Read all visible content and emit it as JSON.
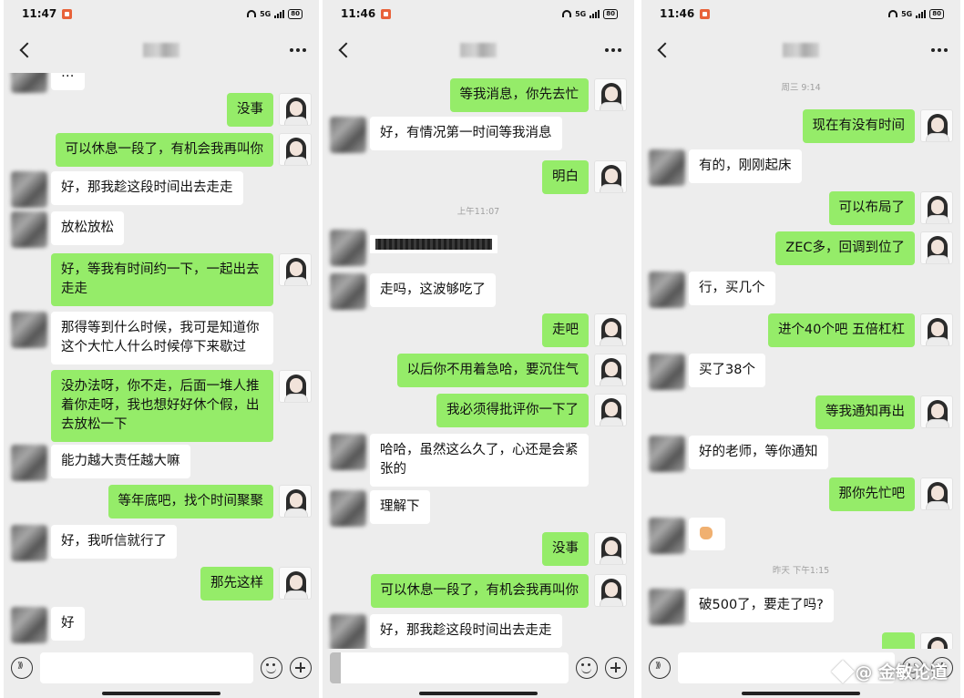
{
  "panels": [
    {
      "status": {
        "time": "11:47",
        "network": "5G",
        "battery": "80"
      },
      "messages": [
        {
          "side": "in",
          "text": "…"
        },
        {
          "side": "out",
          "text": "没事"
        },
        {
          "side": "out",
          "text": "可以休息一段了，有机会我再叫你"
        },
        {
          "side": "in",
          "text": "好，那我趁这段时间出去走走"
        },
        {
          "side": "in",
          "text": "放松放松"
        },
        {
          "side": "out",
          "text": "好，等我有时间约一下，一起出去走走"
        },
        {
          "side": "in",
          "text": "那得等到什么时候，我可是知道你这个大忙人什么时候停下来歇过"
        },
        {
          "side": "out",
          "text": "没办法呀，你不走，后面一堆人推着你走呀，我也想好好休个假，出去放松一下"
        },
        {
          "side": "in",
          "text": "能力越大责任越大嘛"
        },
        {
          "side": "out",
          "text": "等年底吧，找个时间聚聚"
        },
        {
          "side": "in",
          "text": "好，我听信就行了"
        },
        {
          "side": "out",
          "text": "那先这样"
        },
        {
          "side": "in",
          "text": "好"
        }
      ]
    },
    {
      "status": {
        "time": "11:46",
        "network": "5G",
        "battery": "80"
      },
      "messages": [
        {
          "side": "out",
          "text": "等我消息，你先去忙"
        },
        {
          "side": "in",
          "text": "好，有情况第一时间等我消息"
        },
        {
          "side": "out",
          "text": "明白"
        },
        {
          "type": "time",
          "text": "上午11:07"
        },
        {
          "side": "in",
          "text": "",
          "redacted": true
        },
        {
          "side": "in",
          "text": "走吗，这波够吃了"
        },
        {
          "side": "out",
          "text": "走吧"
        },
        {
          "side": "out",
          "text": "以后你不用着急哈，要沉住气"
        },
        {
          "side": "out",
          "text": "我必须得批评你一下了"
        },
        {
          "side": "in",
          "text": "哈哈，虽然这么久了，心还是会紧张的"
        },
        {
          "side": "in",
          "text": "理解下"
        },
        {
          "side": "out",
          "text": "没事"
        },
        {
          "side": "out",
          "text": "可以休息一段了，有机会我再叫你"
        },
        {
          "side": "in",
          "text": "好，那我趁这段时间出去走走"
        }
      ]
    },
    {
      "status": {
        "time": "11:46",
        "network": "5G",
        "battery": "80"
      },
      "messages": [
        {
          "type": "time",
          "text": "周三 9:14"
        },
        {
          "side": "out",
          "text": "现在有没有时间"
        },
        {
          "side": "in",
          "text": "有的，刚刚起床"
        },
        {
          "side": "out",
          "text": "可以布局了"
        },
        {
          "side": "out",
          "text": "ZEC多，回调到位了"
        },
        {
          "side": "in",
          "text": "行，买几个"
        },
        {
          "side": "out",
          "text": "进个40个吧 五倍杠杠"
        },
        {
          "side": "in",
          "text": "买了38个"
        },
        {
          "side": "out",
          "text": "等我通知再出"
        },
        {
          "side": "in",
          "text": "好的老师，等你通知"
        },
        {
          "side": "out",
          "text": "那你先忙吧"
        },
        {
          "side": "in",
          "emoji": "hand-icon"
        },
        {
          "type": "time",
          "text": "昨天 下午1:15"
        },
        {
          "side": "in",
          "text": "破500了，要走了吗?"
        },
        {
          "side": "out",
          "text": "…"
        }
      ]
    }
  ],
  "watermark": "@ 金敏论道",
  "colors": {
    "out_bubble": "#95ec69",
    "in_bubble": "#ffffff",
    "background": "#ededed"
  }
}
